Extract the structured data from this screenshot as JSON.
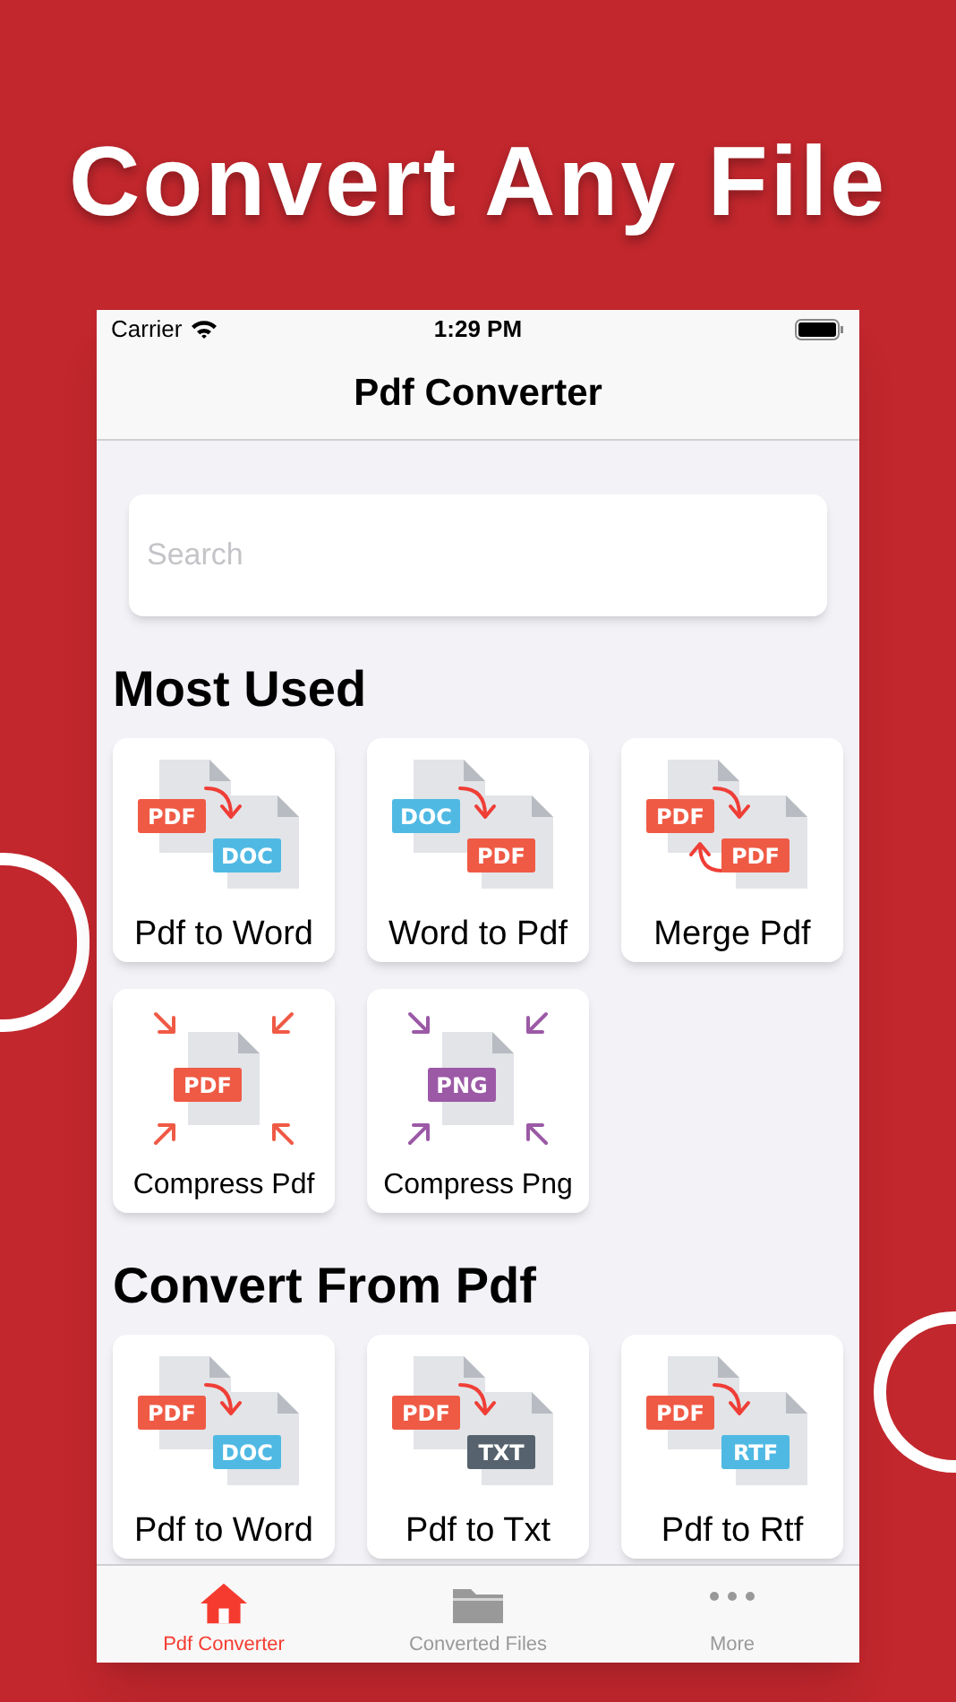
{
  "headline": "Convert Any File",
  "status_bar": {
    "carrier": "Carrier",
    "time": "1:29 PM"
  },
  "nav_bar": {
    "title": "Pdf Converter"
  },
  "search": {
    "placeholder": "Search"
  },
  "sections": [
    {
      "title": "Most Used",
      "tiles": [
        {
          "kind": "convert",
          "label": "Pdf to Word",
          "from": {
            "text": "PDF",
            "color": "#ef5a45"
          },
          "to": {
            "text": "DOC",
            "color": "#4fb9e3"
          }
        },
        {
          "kind": "convert",
          "label": "Word to Pdf",
          "from": {
            "text": "DOC",
            "color": "#4fb9e3"
          },
          "to": {
            "text": "PDF",
            "color": "#ef5a45"
          }
        },
        {
          "kind": "merge",
          "label": "Merge Pdf",
          "from": {
            "text": "PDF",
            "color": "#ef5a45"
          },
          "to": {
            "text": "PDF",
            "color": "#ef5a45"
          }
        },
        {
          "kind": "compress",
          "label": "Compress Pdf",
          "from": {
            "text": "PDF",
            "color": "#ef5a45"
          }
        },
        {
          "kind": "compress",
          "label": "Compress Png",
          "from": {
            "text": "PNG",
            "color": "#9b59a6"
          }
        }
      ]
    },
    {
      "title": "Convert From Pdf",
      "tiles": [
        {
          "kind": "convert",
          "label": "Pdf to Word",
          "from": {
            "text": "PDF",
            "color": "#ef5a45"
          },
          "to": {
            "text": "DOC",
            "color": "#4fb9e3"
          }
        },
        {
          "kind": "convert",
          "label": "Pdf to Txt",
          "from": {
            "text": "PDF",
            "color": "#ef5a45"
          },
          "to": {
            "text": "TXT",
            "color": "#56636e"
          }
        },
        {
          "kind": "convert",
          "label": "Pdf to Rtf",
          "from": {
            "text": "PDF",
            "color": "#ef5a45"
          },
          "to": {
            "text": "RTF",
            "color": "#4fb9e3"
          }
        }
      ]
    }
  ],
  "tab_bar": [
    {
      "kind": "home",
      "label": "Pdf Converter",
      "selected": true
    },
    {
      "kind": "folder",
      "label": "Converted Files",
      "selected": false
    },
    {
      "kind": "more",
      "label": "More",
      "selected": false
    }
  ]
}
